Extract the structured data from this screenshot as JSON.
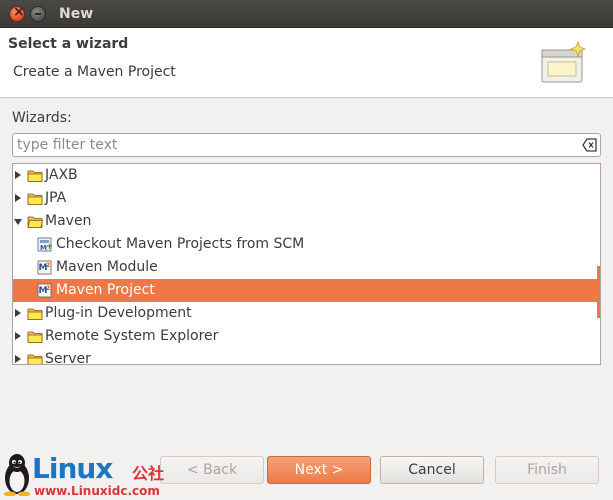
{
  "window": {
    "title": "New"
  },
  "banner": {
    "title": "Select a wizard",
    "description": "Create a Maven Project"
  },
  "wizards": {
    "label": "Wizards:",
    "filter_placeholder": "type filter text",
    "items": [
      {
        "label": "JAXB",
        "icon": "folder-icon",
        "expandable": "collapsed",
        "level": 0
      },
      {
        "label": "JPA",
        "icon": "folder-icon",
        "expandable": "collapsed",
        "level": 0
      },
      {
        "label": "Maven",
        "icon": "folder-icon",
        "expandable": "expanded",
        "level": 0
      },
      {
        "label": "Checkout Maven Projects from SCM",
        "icon": "maven-checkout-icon",
        "level": 1
      },
      {
        "label": "Maven Module",
        "icon": "maven-module-icon",
        "level": 1
      },
      {
        "label": "Maven Project",
        "icon": "maven-project-icon",
        "level": 1,
        "selected": true
      },
      {
        "label": "Plug-in Development",
        "icon": "folder-icon",
        "expandable": "collapsed",
        "level": 0
      },
      {
        "label": "Remote System Explorer",
        "icon": "folder-icon",
        "expandable": "collapsed",
        "level": 0
      },
      {
        "label": "Server",
        "icon": "folder-icon",
        "expandable": "collapsed",
        "level": 0
      }
    ]
  },
  "buttons": {
    "back": "< Back",
    "next": "Next >",
    "cancel": "Cancel",
    "finish": "Finish"
  },
  "watermark": {
    "brand": "Linux",
    "cjk": "公社",
    "url": "www.Linuxidc.com"
  },
  "colors": {
    "selection": "#f07746",
    "titlebar": "#3b3a37",
    "brand_blue": "#1a76c0",
    "brand_red": "#d9363a"
  }
}
